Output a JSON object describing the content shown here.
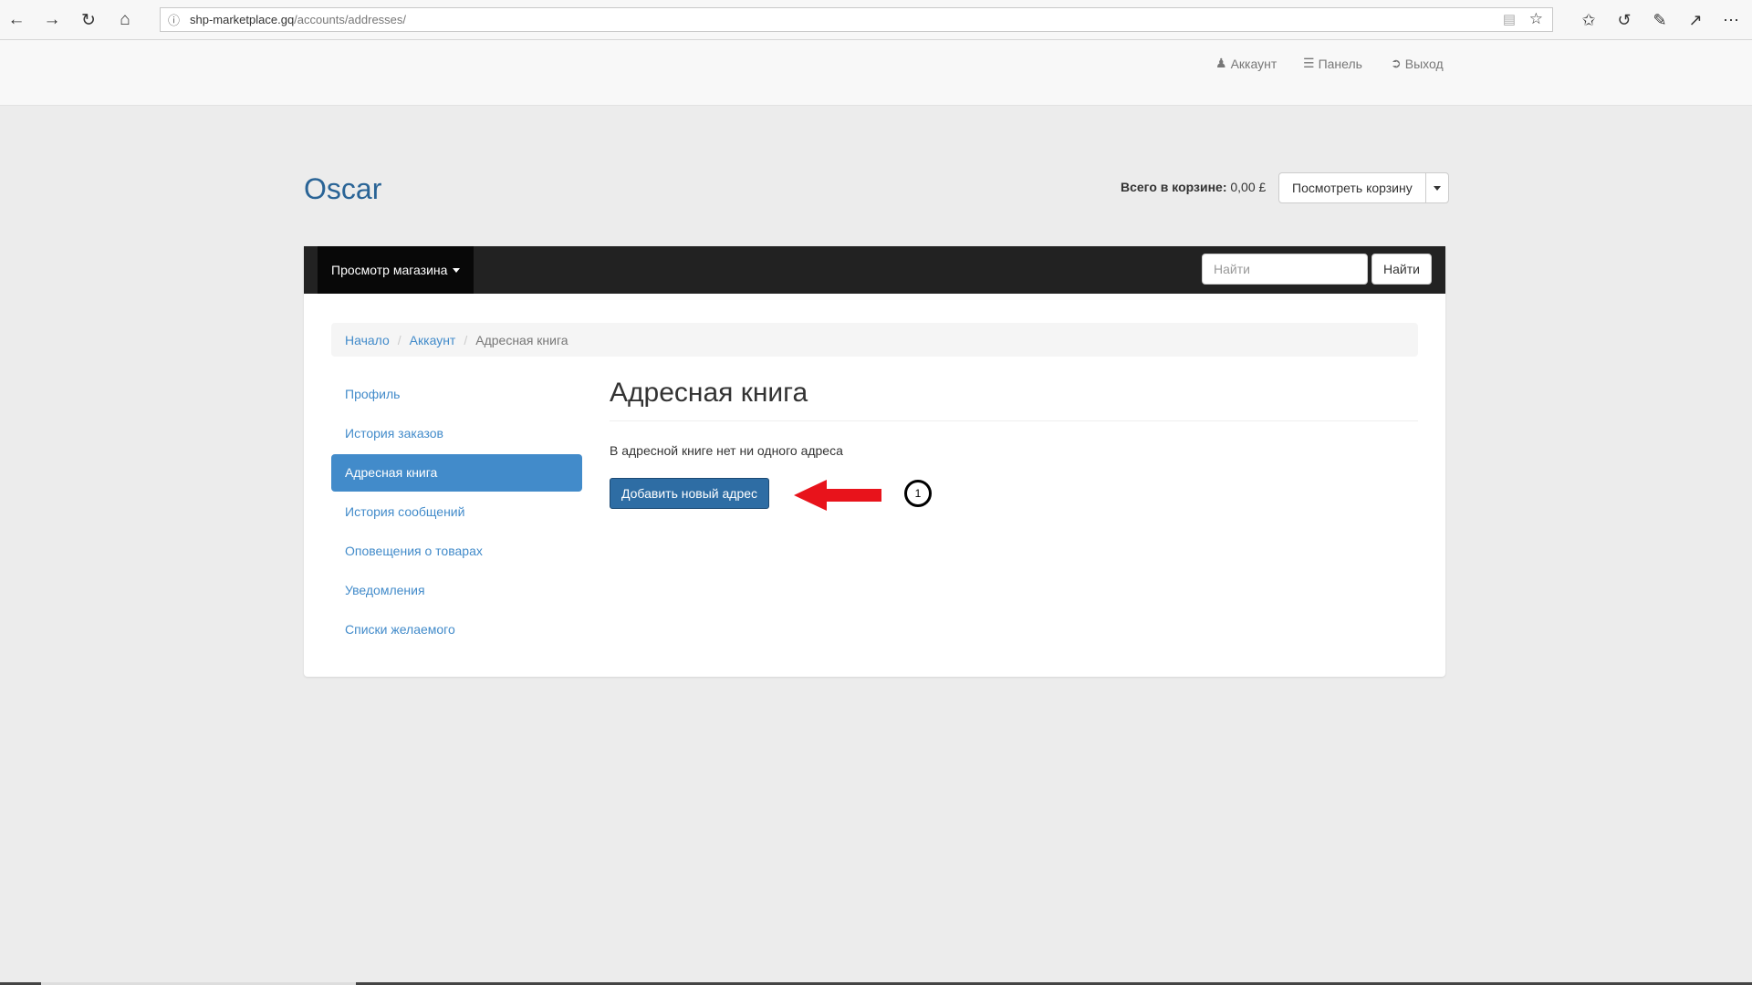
{
  "browser": {
    "url_host": "shp-marketplace.gq",
    "url_path": "/accounts/addresses/",
    "icons": [
      "back-icon",
      "forward-icon",
      "refresh-icon",
      "home-icon",
      "info-icon",
      "reader-icon",
      "star-icon",
      "favorites-icon",
      "history-icon",
      "pen-icon",
      "share-icon"
    ]
  },
  "top_links": {
    "account": "Аккаунт",
    "dashboard": "Панель",
    "logout": "Выход"
  },
  "header": {
    "brand": "Oscar",
    "basket_label": "Всего в корзине:",
    "basket_total": "0,00 £",
    "view_basket": "Посмотреть корзину"
  },
  "navbar": {
    "browse": "Просмотр магазина",
    "search_placeholder": "Найти",
    "search_button": "Найти"
  },
  "breadcrumb": {
    "home": "Начало",
    "account": "Аккаунт",
    "current": "Адресная книга"
  },
  "sidebar": {
    "items": [
      {
        "label": "Профиль",
        "active": false
      },
      {
        "label": "История заказов",
        "active": false
      },
      {
        "label": "Адресная книга",
        "active": true
      },
      {
        "label": "История сообщений",
        "active": false
      },
      {
        "label": "Оповещения о товарах",
        "active": false
      },
      {
        "label": "Уведомления",
        "active": false
      },
      {
        "label": "Списки желаемого",
        "active": false
      }
    ]
  },
  "main": {
    "title": "Адресная книга",
    "empty_message": "В адресной книге нет ни одного адреса",
    "add_button": "Добавить новый адрес"
  },
  "annotation": {
    "step": "1",
    "arrow_color": "#e8131b"
  },
  "colors": {
    "link": "#428bca",
    "navbar": "#222222",
    "primary_button": "#2e6da4"
  }
}
